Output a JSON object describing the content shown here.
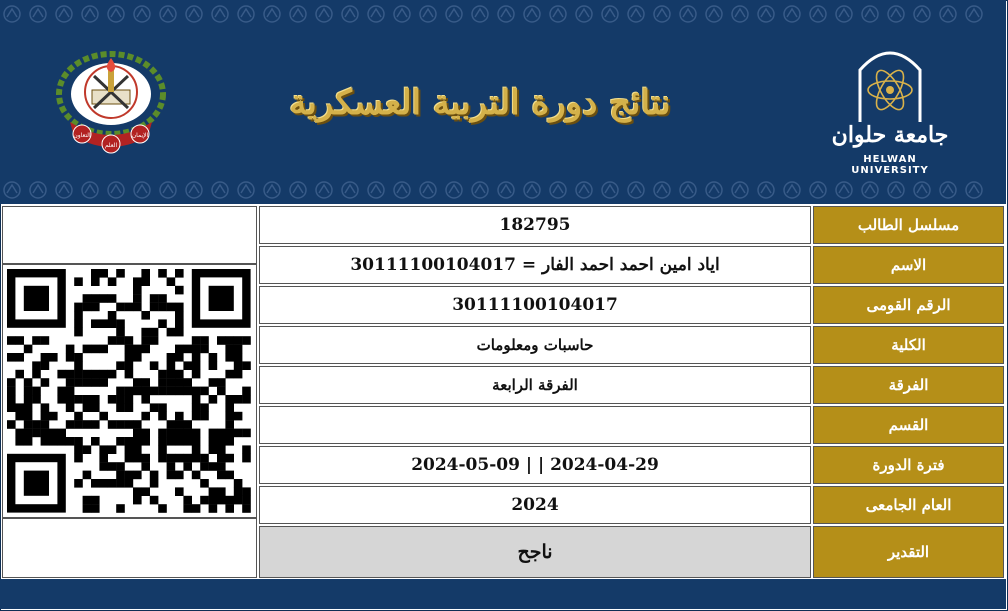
{
  "header": {
    "title": "نتائج دورة التربية العسكرية",
    "university_ar": "جامعة حلوان",
    "university_en": "HELWAN UNIVERSITY",
    "emblem_words": [
      "الإيمان",
      "العلم",
      "التعاون"
    ]
  },
  "colors": {
    "header_bg": "#143a68",
    "label_bg": "#b58f18",
    "title_gold": "#d4b14a",
    "grade_bg": "#d6d6d6"
  },
  "rows": [
    {
      "label": "مسلسل الطالب",
      "value": "182795"
    },
    {
      "label": "الاسم",
      "value": "اياد امين احمد احمد الفار = 30111100104017"
    },
    {
      "label": "الرقم القومى",
      "value": "30111100104017"
    },
    {
      "label": "الكلية",
      "value": "حاسبات ومعلومات"
    },
    {
      "label": "الفرقة",
      "value": "الفرقة الرابعة"
    },
    {
      "label": "القسم",
      "value": ""
    },
    {
      "label": "فترة الدورة",
      "value": "2024-04-29 | | 2024-05-09"
    },
    {
      "label": "العام الجامعى",
      "value": "2024"
    },
    {
      "label": "التقدير",
      "value": "ناجح"
    }
  ]
}
